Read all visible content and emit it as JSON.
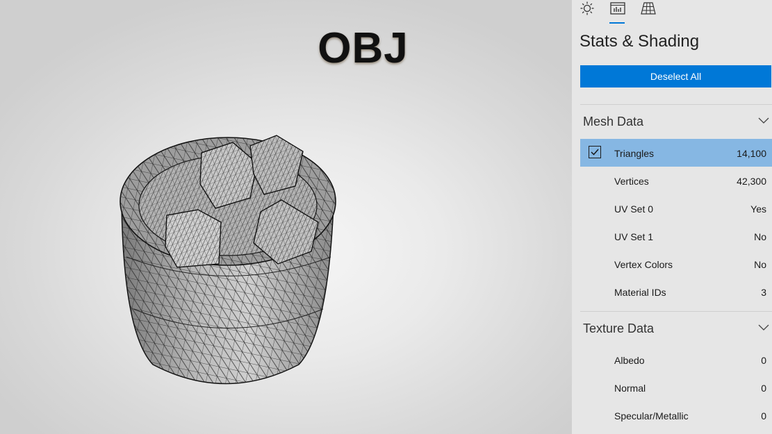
{
  "overlay": {
    "title": "OBJ"
  },
  "panel": {
    "tabs": [
      {
        "icon": "sun-icon"
      },
      {
        "icon": "stats-chart-icon",
        "active": true
      },
      {
        "icon": "grid-icon"
      }
    ],
    "title": "Stats & Shading",
    "deselect_label": "Deselect All",
    "mesh_section": {
      "label": "Mesh Data",
      "rows": [
        {
          "name": "Triangles",
          "value": "14,100",
          "checked": true
        },
        {
          "name": "Vertices",
          "value": "42,300"
        },
        {
          "name": "UV Set 0",
          "value": "Yes"
        },
        {
          "name": "UV Set 1",
          "value": "No"
        },
        {
          "name": "Vertex Colors",
          "value": "No"
        },
        {
          "name": "Material IDs",
          "value": "3"
        }
      ]
    },
    "texture_section": {
      "label": "Texture Data",
      "rows": [
        {
          "name": "Albedo",
          "value": "0"
        },
        {
          "name": "Normal",
          "value": "0"
        },
        {
          "name": "Specular/Metallic",
          "value": "0"
        }
      ]
    }
  },
  "colors": {
    "accent": "#0078d7",
    "selected_row": "#86b7e3",
    "panel_bg": "#e6e6e6"
  }
}
